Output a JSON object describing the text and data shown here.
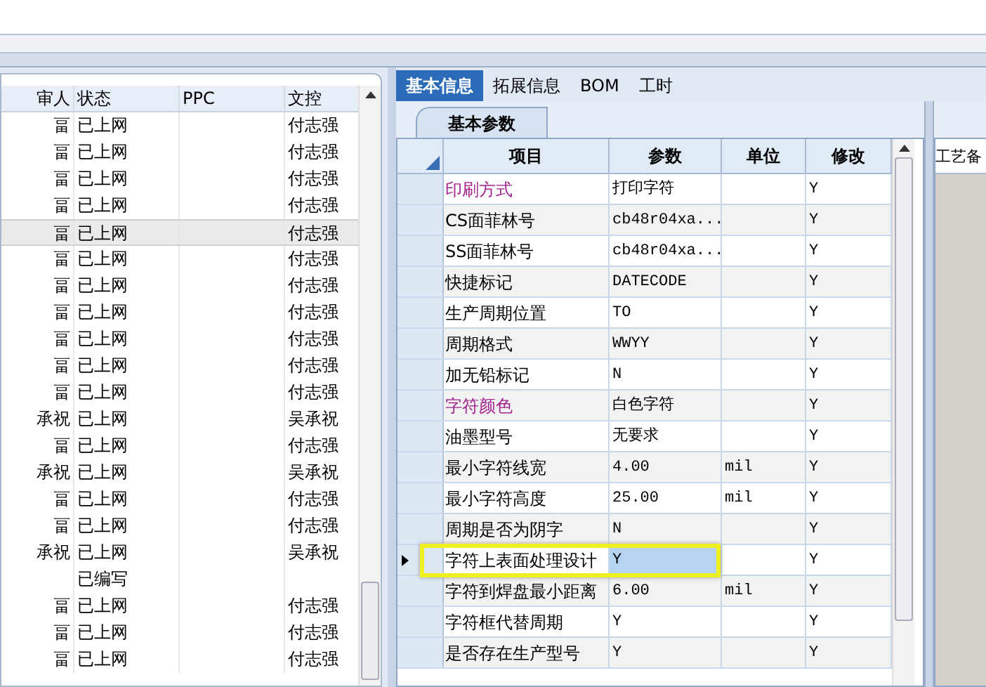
{
  "left_table": {
    "columns": [
      "审人",
      "状态",
      "PPC",
      "文控"
    ],
    "rows": [
      {
        "cells": [
          "畐",
          "已上网",
          "",
          "付志强"
        ],
        "selected": false
      },
      {
        "cells": [
          "畐",
          "已上网",
          "",
          "付志强"
        ],
        "selected": false
      },
      {
        "cells": [
          "畐",
          "已上网",
          "",
          "付志强"
        ],
        "selected": false
      },
      {
        "cells": [
          "畐",
          "已上网",
          "",
          "付志强"
        ],
        "selected": false
      },
      {
        "cells": [
          "畐",
          "已上网",
          "",
          "付志强"
        ],
        "selected": true
      },
      {
        "cells": [
          "畐",
          "已上网",
          "",
          "付志强"
        ],
        "selected": false
      },
      {
        "cells": [
          "畐",
          "已上网",
          "",
          "付志强"
        ],
        "selected": false
      },
      {
        "cells": [
          "畐",
          "已上网",
          "",
          "付志强"
        ],
        "selected": false
      },
      {
        "cells": [
          "畐",
          "已上网",
          "",
          "付志强"
        ],
        "selected": false
      },
      {
        "cells": [
          "畐",
          "已上网",
          "",
          "付志强"
        ],
        "selected": false
      },
      {
        "cells": [
          "畐",
          "已上网",
          "",
          "付志强"
        ],
        "selected": false
      },
      {
        "cells": [
          "承祝",
          "已上网",
          "",
          "吴承祝"
        ],
        "selected": false
      },
      {
        "cells": [
          "畐",
          "已上网",
          "",
          "付志强"
        ],
        "selected": false
      },
      {
        "cells": [
          "承祝",
          "已上网",
          "",
          "吴承祝"
        ],
        "selected": false
      },
      {
        "cells": [
          "畐",
          "已上网",
          "",
          "付志强"
        ],
        "selected": false
      },
      {
        "cells": [
          "畐",
          "已上网",
          "",
          "付志强"
        ],
        "selected": false
      },
      {
        "cells": [
          "承祝",
          "已上网",
          "",
          "吴承祝"
        ],
        "selected": false
      },
      {
        "cells": [
          "",
          "已编写",
          "",
          ""
        ],
        "selected": false
      },
      {
        "cells": [
          "畐",
          "已上网",
          "",
          "付志强"
        ],
        "selected": false
      },
      {
        "cells": [
          "畐",
          "已上网",
          "",
          "付志强"
        ],
        "selected": false
      },
      {
        "cells": [
          "畐",
          "已上网",
          "",
          "付志强"
        ],
        "selected": false
      }
    ]
  },
  "tabs": [
    {
      "label": "基本信息",
      "selected": true
    },
    {
      "label": "拓展信息",
      "selected": false
    },
    {
      "label": "BOM",
      "selected": false
    },
    {
      "label": "工时",
      "selected": false
    }
  ],
  "sub_tab": "基本参数",
  "param_grid": {
    "columns": [
      "项目",
      "参数",
      "单位",
      "修改"
    ],
    "rows": [
      {
        "item": "印刷方式",
        "value": "打印字符",
        "unit": "",
        "editable": "Y",
        "emphasized": true,
        "selected": false
      },
      {
        "item": "CS面菲林号",
        "value": "cb48r04xa...",
        "unit": "",
        "editable": "Y",
        "emphasized": false,
        "selected": false
      },
      {
        "item": "SS面菲林号",
        "value": "cb48r04xa...",
        "unit": "",
        "editable": "Y",
        "emphasized": false,
        "selected": false
      },
      {
        "item": "快捷标记",
        "value": "DATECODE",
        "unit": "",
        "editable": "Y",
        "emphasized": false,
        "selected": false
      },
      {
        "item": "生产周期位置",
        "value": "TO",
        "unit": "",
        "editable": "Y",
        "emphasized": false,
        "selected": false
      },
      {
        "item": "周期格式",
        "value": "WWYY",
        "unit": "",
        "editable": "Y",
        "emphasized": false,
        "selected": false
      },
      {
        "item": "加无铅标记",
        "value": "N",
        "unit": "",
        "editable": "Y",
        "emphasized": false,
        "selected": false
      },
      {
        "item": "字符颜色",
        "value": "白色字符",
        "unit": "",
        "editable": "Y",
        "emphasized": true,
        "selected": false
      },
      {
        "item": "油墨型号",
        "value": "无要求",
        "unit": "",
        "editable": "Y",
        "emphasized": false,
        "selected": false
      },
      {
        "item": "最小字符线宽",
        "value": "4.00",
        "unit": "mil",
        "editable": "Y",
        "emphasized": false,
        "selected": false
      },
      {
        "item": "最小字符高度",
        "value": "25.00",
        "unit": "mil",
        "editable": "Y",
        "emphasized": false,
        "selected": false
      },
      {
        "item": "周期是否为阴字",
        "value": "N",
        "unit": "",
        "editable": "Y",
        "emphasized": false,
        "selected": false
      },
      {
        "item": "字符上表面处理设计",
        "value": "Y",
        "unit": "",
        "editable": "Y",
        "emphasized": false,
        "selected": true
      },
      {
        "item": "字符到焊盘最小距离",
        "value": "6.00",
        "unit": "mil",
        "editable": "Y",
        "emphasized": false,
        "selected": false
      },
      {
        "item": "字符框代替周期",
        "value": "Y",
        "unit": "",
        "editable": "Y",
        "emphasized": false,
        "selected": false
      },
      {
        "item": "是否存在生产型号",
        "value": "Y",
        "unit": "",
        "editable": "Y",
        "emphasized": false,
        "selected": false
      }
    ]
  },
  "side_panel": {
    "header": "工艺备"
  }
}
